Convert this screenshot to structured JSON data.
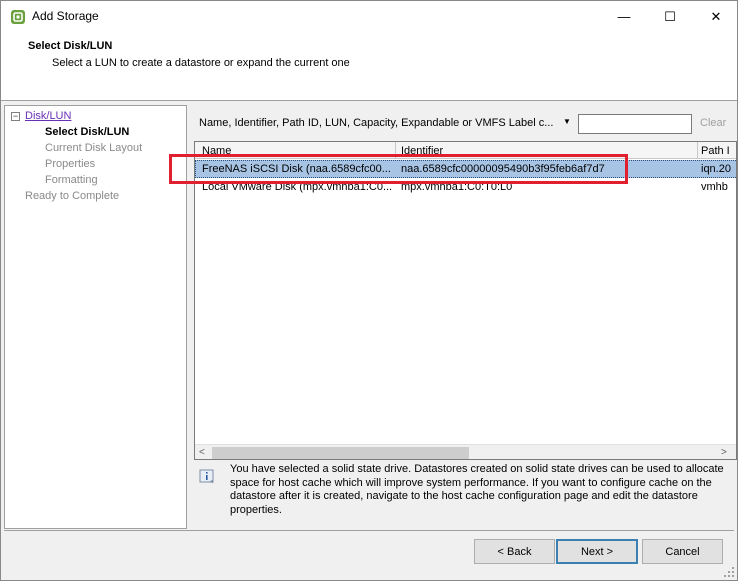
{
  "window": {
    "title": "Add Storage",
    "minimize_glyph": "—",
    "maximize_glyph": "☐",
    "close_glyph": "✕",
    "icon": "vsphere-icon"
  },
  "header": {
    "title": "Select Disk/LUN",
    "subtitle": "Select a LUN to create a datastore or expand the current one"
  },
  "nav": {
    "toggle": "−",
    "items": [
      {
        "label": "Disk/LUN",
        "state": "link"
      },
      {
        "label": "Select Disk/LUN",
        "state": "active"
      },
      {
        "label": "Current Disk Layout",
        "state": "disabled"
      },
      {
        "label": "Properties",
        "state": "disabled"
      },
      {
        "label": "Formatting",
        "state": "disabled"
      },
      {
        "label": "Ready to Complete",
        "state": "disabled"
      }
    ]
  },
  "filter": {
    "label": "Name, Identifier, Path ID, LUN, Capacity, Expandable or VMFS Label c...",
    "arrow": "▼",
    "value": "",
    "clear_label": "Clear"
  },
  "table": {
    "columns": [
      "Name",
      "Identifier",
      "Path I"
    ],
    "rows": [
      {
        "name": "FreeNAS iSCSI Disk (naa.6589cfc00...",
        "identifier": "naa.6589cfc00000095490b3f95feb6af7d7",
        "path": "iqn.20",
        "selected": true
      },
      {
        "name": "Local VMware Disk (mpx.vmhba1:C0...",
        "identifier": "mpx.vmhba1:C0:T0:L0",
        "path": "vmhb",
        "selected": false
      }
    ]
  },
  "scrollbar": {
    "left_glyph": "<",
    "right_glyph": ">"
  },
  "info": {
    "icon": "info-icon",
    "text": "You have selected a solid state drive. Datastores created on solid state drives can be used to allocate space for host cache which will improve system performance. If you want to configure cache on the datastore after it is created, navigate to the host cache configuration page and edit the datastore properties."
  },
  "buttons": {
    "back": "< Back",
    "next": "Next >",
    "cancel": "Cancel"
  },
  "colors": {
    "highlight": "#e0202e",
    "selection": "#a8c4e4",
    "link": "#6a2fb8"
  }
}
